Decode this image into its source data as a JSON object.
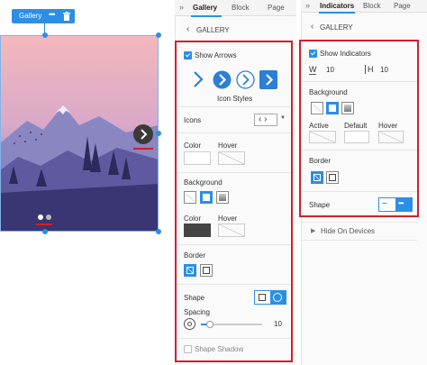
{
  "canvas": {
    "gallery_label": "Gallery",
    "more_icon": "more-icon",
    "trash_icon": "trash-icon"
  },
  "panel1": {
    "tabs": [
      "Gallery",
      "Block",
      "Page"
    ],
    "back_label": "GALLERY",
    "show_arrows": "Show Arrows",
    "icon_styles": "Icon Styles",
    "icons": "Icons",
    "color": "Color",
    "hover": "Hover",
    "background": "Background",
    "color2": "Color",
    "hover2": "Hover",
    "border": "Border",
    "shape": "Shape",
    "spacing": "Spacing",
    "spacing_value": "10",
    "spacing_fraction": 0.15,
    "shape_shadow": "Shape Shadow"
  },
  "panel2": {
    "tabs": [
      "Indicators",
      "Block",
      "Page"
    ],
    "back_label": "GALLERY",
    "show_indicators": "Show Indicators",
    "w_label": "W",
    "w_value": "10",
    "h_label": "H",
    "h_value": "10",
    "background": "Background",
    "active": "Active",
    "default": "Default",
    "hover": "Hover",
    "border": "Border",
    "shape": "Shape",
    "hide_on_devices": "Hide On Devices"
  },
  "colors": {
    "accent": "#2d8ee6",
    "highlight_red": "#d0202a",
    "arrow_blue": "#2d7fd6",
    "dark_swatch": "#444444"
  }
}
